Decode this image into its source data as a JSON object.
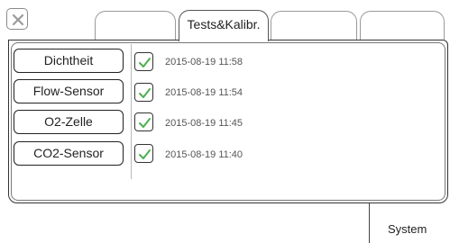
{
  "tabs": [
    {
      "label": ""
    },
    {
      "label": "Tests&Kalibr."
    },
    {
      "label": ""
    },
    {
      "label": ""
    }
  ],
  "tests": [
    {
      "name": "Dichtheit",
      "status": "passed",
      "timestamp": "2015-08-19 11:58"
    },
    {
      "name": "Flow-Sensor",
      "status": "passed",
      "timestamp": "2015-08-19 11:54"
    },
    {
      "name": "O2-Zelle",
      "status": "passed",
      "timestamp": "2015-08-19 11:45"
    },
    {
      "name": "CO2-Sensor",
      "status": "passed",
      "timestamp": "2015-08-19 11:40"
    }
  ],
  "bottom_tab": {
    "label": "System"
  },
  "icons": {
    "close": "close-icon",
    "check": "check-icon"
  },
  "colors": {
    "check": "#4caf50",
    "close_x": "#9a9a9a"
  }
}
